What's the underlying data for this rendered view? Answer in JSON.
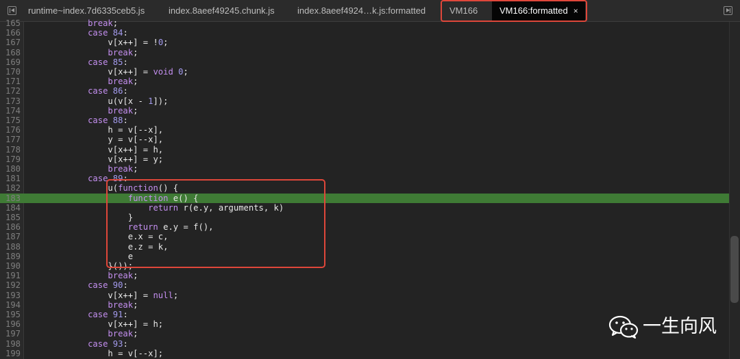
{
  "tabs": [
    {
      "label": "runtime~index.7d6335ceb5.js",
      "active": false
    },
    {
      "label": "index.8aeef49245.chunk.js",
      "active": false
    },
    {
      "label": "index.8aeef4924…k.js:formatted",
      "active": false
    },
    {
      "label": "VM166",
      "active": false
    },
    {
      "label": "VM166:formatted",
      "active": true,
      "close": "×"
    }
  ],
  "colors": {
    "highlight_line": "#3f7b35",
    "annotation_box": "#e0473a",
    "keyword": "#c48ff0",
    "number": "#a59cf0"
  },
  "icons": {
    "left_nav": "toggle-navigator-icon",
    "right_nav": "toggle-debugger-icon",
    "watermark": "wechat-icon"
  },
  "editor": {
    "highlighted_line": 183,
    "lines": [
      {
        "n": "165",
        "segs": [
          [
            "",
            "            "
          ],
          [
            "kw",
            "break"
          ],
          [
            "",
            ";"
          ]
        ]
      },
      {
        "n": "166",
        "segs": [
          [
            "",
            "            "
          ],
          [
            "kw",
            "case"
          ],
          [
            "",
            " "
          ],
          [
            "num",
            "84"
          ],
          [
            "",
            ":"
          ]
        ]
      },
      {
        "n": "167",
        "segs": [
          [
            "",
            "                v[x"
          ],
          [
            "op",
            "++"
          ],
          [
            "",
            "] = "
          ],
          [
            "op",
            "!"
          ],
          [
            "num",
            "0"
          ],
          [
            "",
            ";"
          ]
        ]
      },
      {
        "n": "168",
        "segs": [
          [
            "",
            "                "
          ],
          [
            "kw",
            "break"
          ],
          [
            "",
            ";"
          ]
        ]
      },
      {
        "n": "169",
        "segs": [
          [
            "",
            "            "
          ],
          [
            "kw",
            "case"
          ],
          [
            "",
            " "
          ],
          [
            "num",
            "85"
          ],
          [
            "",
            ":"
          ]
        ]
      },
      {
        "n": "170",
        "segs": [
          [
            "",
            "                v[x"
          ],
          [
            "op",
            "++"
          ],
          [
            "",
            "] = "
          ],
          [
            "kw",
            "void"
          ],
          [
            "",
            " "
          ],
          [
            "num",
            "0"
          ],
          [
            "",
            ";"
          ]
        ]
      },
      {
        "n": "171",
        "segs": [
          [
            "",
            "                "
          ],
          [
            "kw",
            "break"
          ],
          [
            "",
            ";"
          ]
        ]
      },
      {
        "n": "172",
        "segs": [
          [
            "",
            "            "
          ],
          [
            "kw",
            "case"
          ],
          [
            "",
            " "
          ],
          [
            "num",
            "86"
          ],
          [
            "",
            ":"
          ]
        ]
      },
      {
        "n": "173",
        "segs": [
          [
            "",
            "                u(v[x "
          ],
          [
            "op",
            "-"
          ],
          [
            "",
            " "
          ],
          [
            "num",
            "1"
          ],
          [
            "",
            "]);"
          ]
        ]
      },
      {
        "n": "174",
        "segs": [
          [
            "",
            "                "
          ],
          [
            "kw",
            "break"
          ],
          [
            "",
            ";"
          ]
        ]
      },
      {
        "n": "175",
        "segs": [
          [
            "",
            "            "
          ],
          [
            "kw",
            "case"
          ],
          [
            "",
            " "
          ],
          [
            "num",
            "88"
          ],
          [
            "",
            ":"
          ]
        ]
      },
      {
        "n": "176",
        "segs": [
          [
            "",
            "                h = v["
          ],
          [
            "op",
            "--"
          ],
          [
            "",
            "x],"
          ]
        ]
      },
      {
        "n": "177",
        "segs": [
          [
            "",
            "                y = v["
          ],
          [
            "op",
            "--"
          ],
          [
            "",
            "x],"
          ]
        ]
      },
      {
        "n": "178",
        "segs": [
          [
            "",
            "                v[x"
          ],
          [
            "op",
            "++"
          ],
          [
            "",
            "] = h,"
          ]
        ]
      },
      {
        "n": "179",
        "segs": [
          [
            "",
            "                v[x"
          ],
          [
            "op",
            "++"
          ],
          [
            "",
            "] = y;"
          ]
        ]
      },
      {
        "n": "180",
        "segs": [
          [
            "",
            "                "
          ],
          [
            "kw",
            "break"
          ],
          [
            "",
            ";"
          ]
        ]
      },
      {
        "n": "181",
        "segs": [
          [
            "",
            "            "
          ],
          [
            "kw",
            "case"
          ],
          [
            "",
            " "
          ],
          [
            "num",
            "89"
          ],
          [
            "",
            ":"
          ]
        ]
      },
      {
        "n": "182",
        "segs": [
          [
            "",
            "                u("
          ],
          [
            "kw",
            "function"
          ],
          [
            "",
            "() {"
          ]
        ]
      },
      {
        "n": "183",
        "segs": [
          [
            "",
            "                    "
          ],
          [
            "kw",
            "function"
          ],
          [
            "",
            " e() {"
          ]
        ]
      },
      {
        "n": "184",
        "segs": [
          [
            "",
            "                        "
          ],
          [
            "kw",
            "return"
          ],
          [
            "",
            " r(e.y, arguments, k)"
          ]
        ]
      },
      {
        "n": "185",
        "segs": [
          [
            "",
            "                    }"
          ]
        ]
      },
      {
        "n": "186",
        "segs": [
          [
            "",
            "                    "
          ],
          [
            "kw",
            "return"
          ],
          [
            "",
            " e.y = f(),"
          ]
        ]
      },
      {
        "n": "187",
        "segs": [
          [
            "",
            "                    e.x = c,"
          ]
        ]
      },
      {
        "n": "188",
        "segs": [
          [
            "",
            "                    e.z = k,"
          ]
        ]
      },
      {
        "n": "189",
        "segs": [
          [
            "",
            "                    e"
          ]
        ]
      },
      {
        "n": "190",
        "segs": [
          [
            "",
            "                }());"
          ]
        ]
      },
      {
        "n": "191",
        "segs": [
          [
            "",
            "                "
          ],
          [
            "kw",
            "break"
          ],
          [
            "",
            ";"
          ]
        ]
      },
      {
        "n": "192",
        "segs": [
          [
            "",
            "            "
          ],
          [
            "kw",
            "case"
          ],
          [
            "",
            " "
          ],
          [
            "num",
            "90"
          ],
          [
            "",
            ":"
          ]
        ]
      },
      {
        "n": "193",
        "segs": [
          [
            "",
            "                v[x"
          ],
          [
            "op",
            "++"
          ],
          [
            "",
            "] = "
          ],
          [
            "kw",
            "null"
          ],
          [
            "",
            ";"
          ]
        ]
      },
      {
        "n": "194",
        "segs": [
          [
            "",
            "                "
          ],
          [
            "kw",
            "break"
          ],
          [
            "",
            ";"
          ]
        ]
      },
      {
        "n": "195",
        "segs": [
          [
            "",
            "            "
          ],
          [
            "kw",
            "case"
          ],
          [
            "",
            " "
          ],
          [
            "num",
            "91"
          ],
          [
            "",
            ":"
          ]
        ]
      },
      {
        "n": "196",
        "segs": [
          [
            "",
            "                v[x"
          ],
          [
            "op",
            "++"
          ],
          [
            "",
            "] = h;"
          ]
        ]
      },
      {
        "n": "197",
        "segs": [
          [
            "",
            "                "
          ],
          [
            "kw",
            "break"
          ],
          [
            "",
            ";"
          ]
        ]
      },
      {
        "n": "198",
        "segs": [
          [
            "",
            "            "
          ],
          [
            "kw",
            "case"
          ],
          [
            "",
            " "
          ],
          [
            "num",
            "93"
          ],
          [
            "",
            ":"
          ]
        ]
      },
      {
        "n": "199",
        "segs": [
          [
            "",
            "                h = v["
          ],
          [
            "op",
            "--"
          ],
          [
            "",
            "x];"
          ]
        ]
      }
    ]
  },
  "watermark": {
    "text": "一生向风"
  }
}
